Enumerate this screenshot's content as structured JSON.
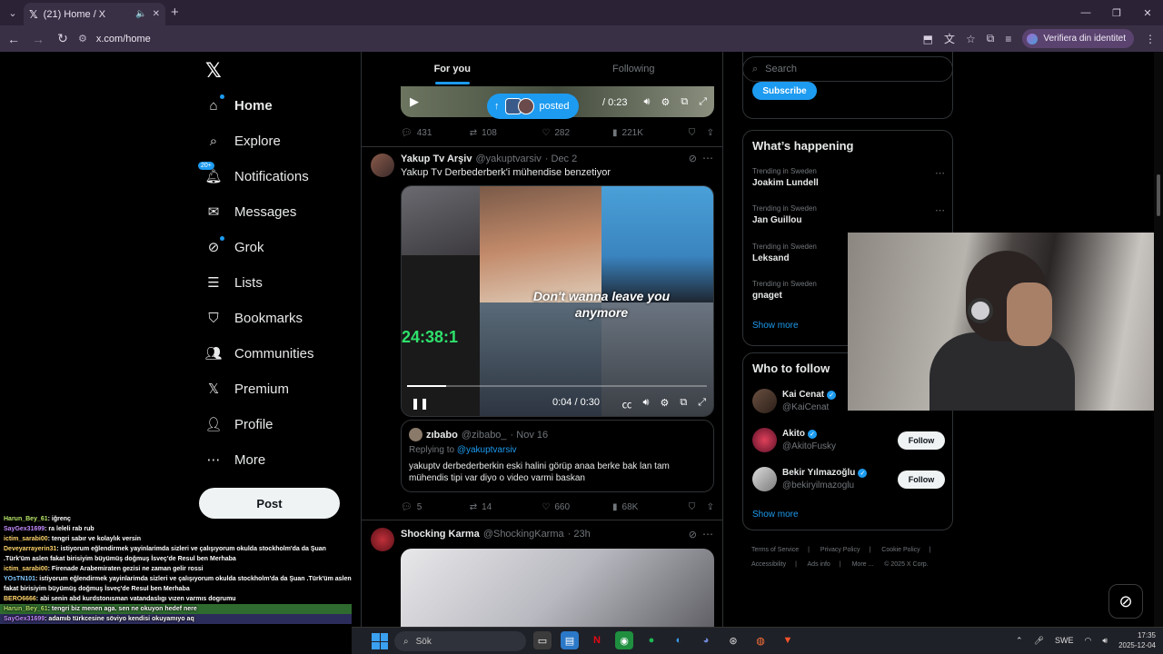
{
  "browser": {
    "tab_title": "(21) Home / X",
    "url": "x.com/home",
    "identity_button": "Verifiera din identitet"
  },
  "nav": {
    "items": [
      {
        "label": "Home",
        "icon": "home-icon"
      },
      {
        "label": "Explore",
        "icon": "search-icon"
      },
      {
        "label": "Notifications",
        "icon": "bell-icon",
        "badge": "20+"
      },
      {
        "label": "Messages",
        "icon": "mail-icon"
      },
      {
        "label": "Grok",
        "icon": "grok-icon"
      },
      {
        "label": "Lists",
        "icon": "list-icon"
      },
      {
        "label": "Bookmarks",
        "icon": "bookmark-icon"
      },
      {
        "label": "Communities",
        "icon": "people-icon"
      },
      {
        "label": "Premium",
        "icon": "x-icon"
      },
      {
        "label": "Profile",
        "icon": "person-icon"
      },
      {
        "label": "More",
        "icon": "more-circle-icon"
      }
    ],
    "post_label": "Post"
  },
  "timeline": {
    "tabs": [
      "For you",
      "Following"
    ],
    "posted_pill": "posted",
    "video_top_time": "/ 0:23",
    "tweet0_actions": {
      "replies": "431",
      "retweets": "108",
      "likes": "282",
      "views": "221K"
    },
    "tweet1": {
      "name": "Yakup Tv Arşiv",
      "handle": "@yakuptvarsiv",
      "date": "· Dec 2",
      "text": "Yakup Tv Derbederberk'i mühendise benzetiyor",
      "overlay_text": "Don't wanna leave you anymore",
      "counter": "24:38:1",
      "video_time": "0:04 / 0:30",
      "progress": 0.13,
      "quote": {
        "name": "zıbabo",
        "handle": "@zibabo_",
        "date": "· Nov 16",
        "replying_prefix": "Replying to",
        "replying_to": "@yakuptvarsiv",
        "text": "yakuptv derbederberkin eski halini görüp anaa berke bak lan tam mühendis tipi var diyo o video varmi baskan"
      },
      "actions": {
        "replies": "5",
        "retweets": "14",
        "likes": "660",
        "views": "68K"
      }
    },
    "tweet2": {
      "name": "Shocking Karma",
      "handle": "@ShockingKarma",
      "date": "· 23h"
    }
  },
  "right": {
    "search_placeholder": "Search",
    "subscribe_label": "Subscribe",
    "whats_happening": {
      "title": "What’s happening",
      "trends": [
        {
          "category": "Trending in Sweden",
          "topic": "Joakim Lundell"
        },
        {
          "category": "Trending in Sweden",
          "topic": "Jan Guillou"
        },
        {
          "category": "Trending in Sweden",
          "topic": "Leksand"
        },
        {
          "category": "Trending in Sweden",
          "topic": "gnaget"
        }
      ],
      "show_more": "Show more"
    },
    "who_to_follow": {
      "title": "Who to follow",
      "users": [
        {
          "name": "Kai Cenat",
          "handle": "@KaiCenat"
        },
        {
          "name": "Akito",
          "handle": "@AkitoFusky",
          "button": "Follow"
        },
        {
          "name": "Bekir Yılmazoğlu",
          "handle": "@bekiryilmazoglu",
          "button": "Follow"
        }
      ],
      "show_more": "Show more"
    },
    "footer": {
      "links": [
        "Terms of Service",
        "|",
        "Privacy Policy",
        "|",
        "Cookie Policy",
        "|",
        "Accessibility",
        "|",
        "Ads info",
        "|",
        "More ...",
        "© 2025 X Corp."
      ]
    }
  },
  "chat": [
    {
      "user": "Harun_Bey_61",
      "msg": ": iğrenç"
    },
    {
      "user": "SayGex31699",
      "msg": ": ra leleli rab rub"
    },
    {
      "user": "ictim_sarabi00",
      "msg": ": tengri sabır ve kolaylık versin"
    },
    {
      "user": "Deveyarrayerin31",
      "msg": ": istiyorum eğlendirmek yayinlarimda sizleri ve çalışıyorum okulda stockholm'da da Şuan .Türk'üm aslen fakat birisiyim büyümüş doğmuş İsveç'de Resul ben Merhaba"
    },
    {
      "user": "ictim_sarabi00",
      "msg": ": Firenade Arabemiraten gezisi ne zaman gelir rossi"
    },
    {
      "user": "YOsTN101",
      "msg": ": istiyorum eğlendirmek yayinlarimda sizleri ve çalışıyorum okulda stockholm'da da Şuan .Türk'üm aslen fakat birisiyim büyümüş doğmuş İsveç'de Resul ben Merhaba"
    },
    {
      "user": "BERO6666",
      "msg": ": abi senin abd kurdstonısman vatandaslıgı vızen varmıs dogrumu"
    },
    {
      "user": "Harun_Bey_61",
      "msg": ": tengri biz menen aga. sen ne okuyon hedef nere"
    },
    {
      "user": "SayGex31699",
      "msg": ": adamıb türkcesine söviyo kendisi okuyamıyo aq"
    }
  ],
  "taskbar": {
    "search_placeholder": "Sök",
    "lang": "SWE",
    "time": "17:35",
    "date": "2025-12-04"
  }
}
